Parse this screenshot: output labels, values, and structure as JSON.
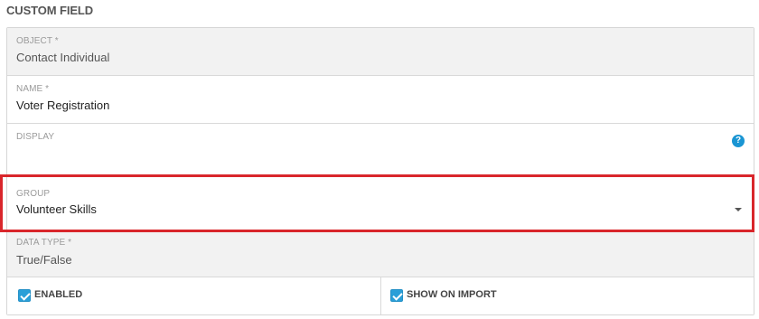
{
  "page_title": "CUSTOM FIELD",
  "fields": {
    "object": {
      "label": "OBJECT *",
      "value": "Contact Individual"
    },
    "name": {
      "label": "NAME *",
      "value": "Voter Registration"
    },
    "display": {
      "label": "DISPLAY",
      "value": "",
      "help_icon": "help-icon",
      "help_glyph": "?"
    },
    "group": {
      "label": "GROUP",
      "value": "Volunteer Skills",
      "icon": "chevron-down-icon"
    },
    "data_type": {
      "label": "DATA TYPE *",
      "value": "True/False"
    }
  },
  "checkboxes": {
    "enabled": {
      "label": "ENABLED",
      "checked": true
    },
    "show_on_import": {
      "label": "SHOW ON IMPORT",
      "checked": true
    }
  },
  "colors": {
    "accent": "#1a95d3",
    "highlight": "#d9262b",
    "readonly_bg": "#f2f2f2"
  }
}
